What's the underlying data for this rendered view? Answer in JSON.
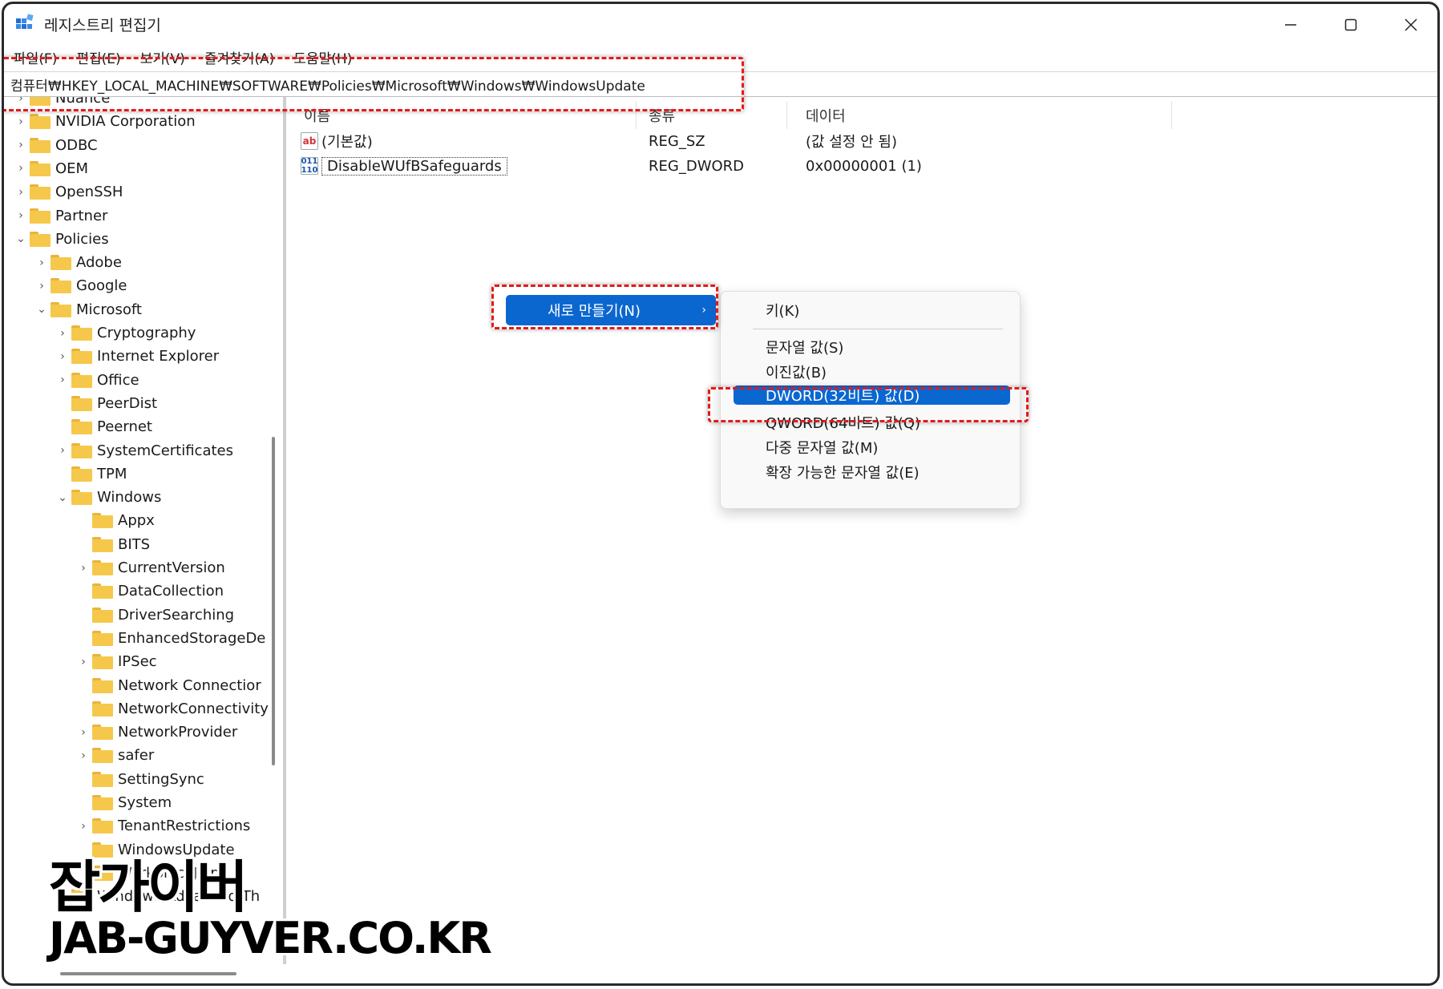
{
  "window": {
    "title": "레지스트리 편집기"
  },
  "menubar": [
    "파일(F)",
    "편집(E)",
    "보기(V)",
    "즐겨찾기(A)",
    "도움말(H)"
  ],
  "address": "컴퓨터₩HKEY_LOCAL_MACHINE₩SOFTWARE₩Policies₩Microsoft₩Windows₩WindowsUpdate",
  "tree": [
    "Nuance",
    "NVIDIA Corporation",
    "ODBC",
    "OEM",
    "OpenSSH",
    "Partner",
    "Policies",
    "Adobe",
    "Google",
    "Microsoft",
    "Cryptography",
    "Internet Explorer",
    "Office",
    "PeerDist",
    "Peernet",
    "SystemCertificates",
    "TPM",
    "Windows",
    "Appx",
    "BITS",
    "CurrentVersion",
    "DataCollection",
    "DriverSearching",
    "EnhancedStorageDe",
    "IPSec",
    "Network Connectior",
    "NetworkConnectivity",
    "NetworkProvider",
    "safer",
    "SettingSync",
    "System",
    "TenantRestrictions",
    "WindowsUpdate",
    "WorkplaceJoin",
    "Windows Advanced Th"
  ],
  "list": {
    "headers": [
      "이름",
      "종류",
      "데이터"
    ],
    "rows": [
      {
        "name": "(기본값)",
        "type": "REG_SZ",
        "data": "(값 설정 안 됨)",
        "icon": "string-value-icon"
      },
      {
        "name": "DisableWUfBSafeguards",
        "type": "REG_DWORD",
        "data": "0x00000001 (1)",
        "icon": "binary-value-icon"
      }
    ]
  },
  "context_menu": {
    "new": "새로 만들기(N)",
    "submenu": [
      "키(K)",
      "문자열 값(S)",
      "이진값(B)",
      "DWORD(32비트) 값(D)",
      "QWORD(64비트) 값(Q)",
      "다중 문자열 값(M)",
      "확장 가능한 문자열 값(E)"
    ],
    "selected": "DWORD(32비트) 값(D)"
  },
  "watermark": {
    "line1": "잡가이버",
    "line2": "JAB-GUYVER.CO.KR"
  },
  "colors": {
    "highlight": "#0b67d0",
    "annotation": "#e31a1a",
    "folder": "#f5c84c"
  }
}
